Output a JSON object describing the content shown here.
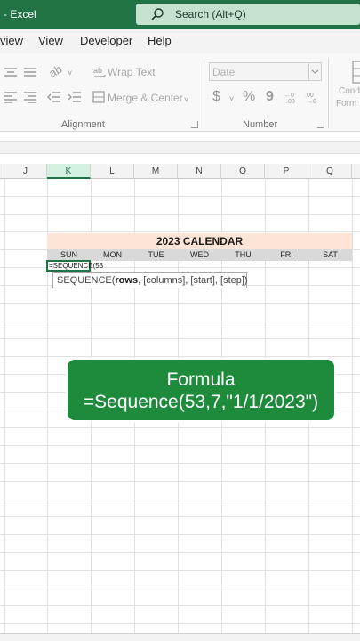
{
  "window": {
    "title": "- Excel"
  },
  "search": {
    "placeholder": "Search (Alt+Q)"
  },
  "menu": {
    "items": [
      "view",
      "View",
      "Developer",
      "Help"
    ]
  },
  "ribbon": {
    "wrap_text": "Wrap Text",
    "merge_center": "Merge & Center",
    "number_format": "Date",
    "currency_symbol": "$",
    "percent_symbol": "%",
    "comma_symbol": "9",
    "cond_line1": "Cond",
    "cond_line2": "Form",
    "groups": {
      "alignment": "Alignment",
      "number": "Number"
    }
  },
  "grid": {
    "columns": [
      "J",
      "K",
      "L",
      "M",
      "N",
      "O",
      "P",
      "Q"
    ],
    "active_column": "K"
  },
  "calendar": {
    "title": "2023 CALENDAR",
    "days": [
      "SUN",
      "MON",
      "TUE",
      "WED",
      "THU",
      "FRI",
      "SAT"
    ]
  },
  "cell": {
    "editing_text": "=SEQUENCE(53"
  },
  "tooltip": {
    "func": "SEQUENCE(",
    "arg_bold": "rows",
    "rest": ", [columns], [start], [step])"
  },
  "overlay": {
    "line1": "Formula",
    "line2": "=Sequence(53,7,\"1/1/2023\")"
  },
  "colors": {
    "accent": "#217346",
    "overlay_bg": "#1e8b3c",
    "calendar_title_bg": "#fce4d6",
    "day_row_bg": "#d9d9d9"
  }
}
